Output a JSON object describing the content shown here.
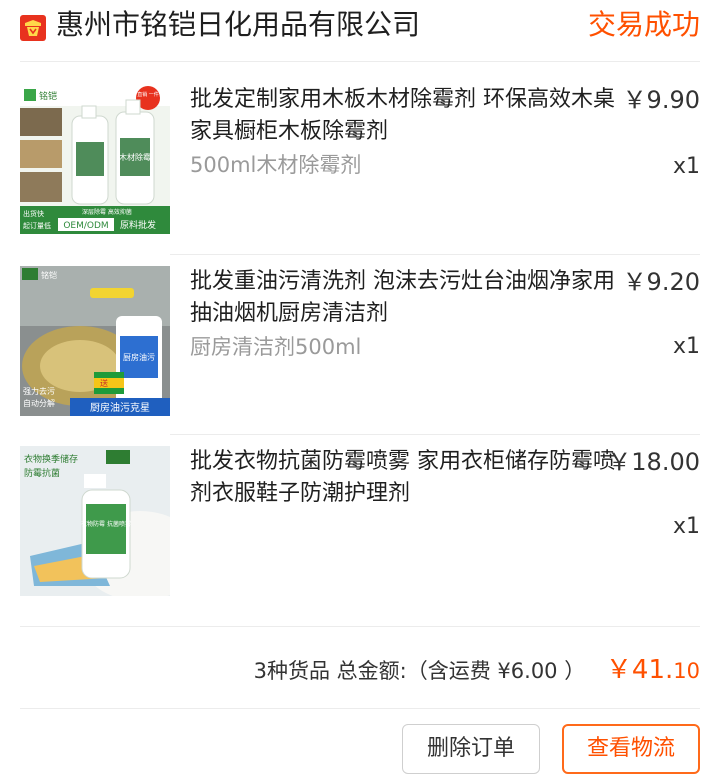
{
  "header": {
    "shop_name": "惠州市铭铠日化用品有限公司",
    "status": "交易成功",
    "shop_icon": "store-badge-icon",
    "colors": {
      "accent": "#ff5000",
      "icon": "#e8321e"
    }
  },
  "items": [
    {
      "title": "批发定制家用木板木材除霉剂 环保高效木桌家具橱柜木板除霉剂",
      "price": "￥9.90",
      "sku": "500ml木材除霉剂",
      "qty": "x1",
      "thumb": {
        "brand": "铭铠",
        "badge": "工厂直销 一件代发",
        "bottle_label": "木材除霉",
        "tag_left_1": "出货快",
        "tag_left_2": "起订量低",
        "tag_mid": "深层除霉 高效抑菌",
        "tag_oem": "OEM/ODM",
        "tag_wholesale": "原料批发"
      }
    },
    {
      "title": "批发重油污清洗剂 泡沫去污灶台油烟净家用抽油烟机厨房清洁剂",
      "price": "￥9.20",
      "sku": "厨房清洁剂500ml",
      "qty": "x1",
      "thumb": {
        "brand": "铭铠",
        "tag_1": "强力去污",
        "tag_2": "自动分解",
        "banner": "厨房油污克星",
        "bottle_label": "厨房油污",
        "sponge_text": "送"
      }
    },
    {
      "title": "批发衣物抗菌防霉喷雾 家用衣柜储存防霉喷剂衣服鞋子防潮护理剂",
      "price": "￥18.00",
      "sku": "",
      "qty": "x1",
      "thumb": {
        "line_1": "衣物换季储存",
        "line_2": "防霉抗菌",
        "bottle_label": "衣物防霉 抗菌喷雾"
      }
    }
  ],
  "summary": {
    "count_text": "3种货品",
    "total_label": "总金额:（含运费 ¥6.00 ）",
    "total_int": "￥41.",
    "total_cents": "10"
  },
  "actions": {
    "delete_label": "删除订单",
    "logistics_label": "查看物流"
  }
}
